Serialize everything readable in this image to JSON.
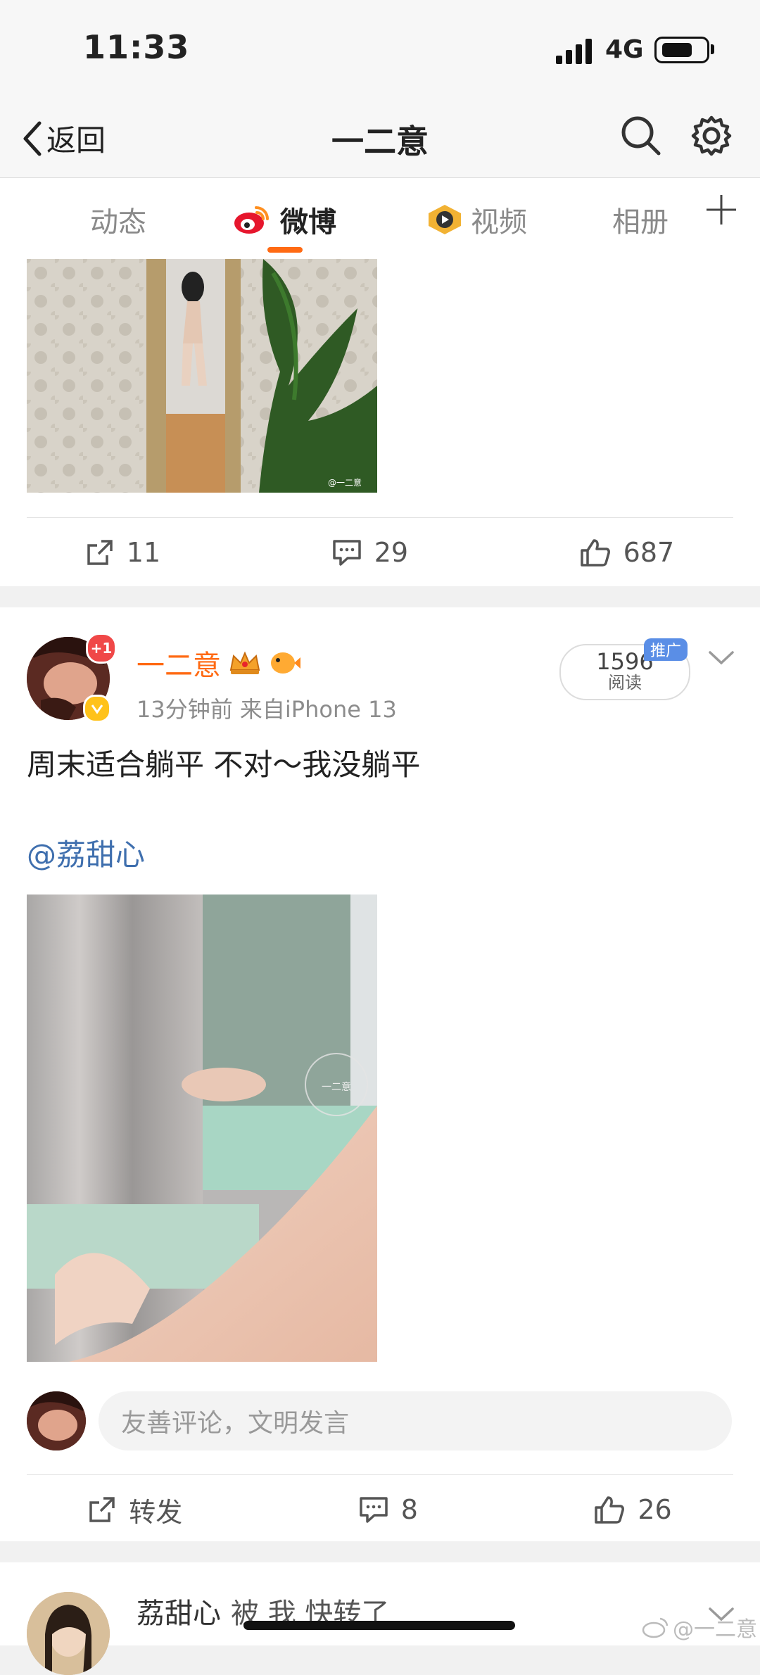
{
  "status_bar": {
    "time": "11:33",
    "network": "4G"
  },
  "nav": {
    "back_label": "返回",
    "title": "一二意"
  },
  "tabs": [
    {
      "label": "动态"
    },
    {
      "label": "微博"
    },
    {
      "label": "视频"
    },
    {
      "label": "相册"
    }
  ],
  "post1": {
    "watermark": "@一二意",
    "actions": {
      "repost_count": "11",
      "comment_count": "29",
      "like_count": "687"
    }
  },
  "post2": {
    "author": "一二意",
    "badge_count": "+1",
    "meta": "13分钟前  来自iPhone 13",
    "reads": "1596",
    "reads_label": "阅读",
    "promo_badge": "推广",
    "text": "周末适合躺平 不对～我没躺平",
    "mention": "@荔甜心",
    "image_watermark": "一二意",
    "comment_placeholder": "友善评论，文明发言",
    "actions": {
      "repost_label": "转发",
      "comment_count": "8",
      "like_count": "26"
    }
  },
  "post3": {
    "author": "荔甜心",
    "text": "被 我 快转了"
  },
  "footer_watermark": "@一二意",
  "colors": {
    "accent": "#ff6a13",
    "link": "#3f6fae",
    "author": "#ff6a13"
  }
}
